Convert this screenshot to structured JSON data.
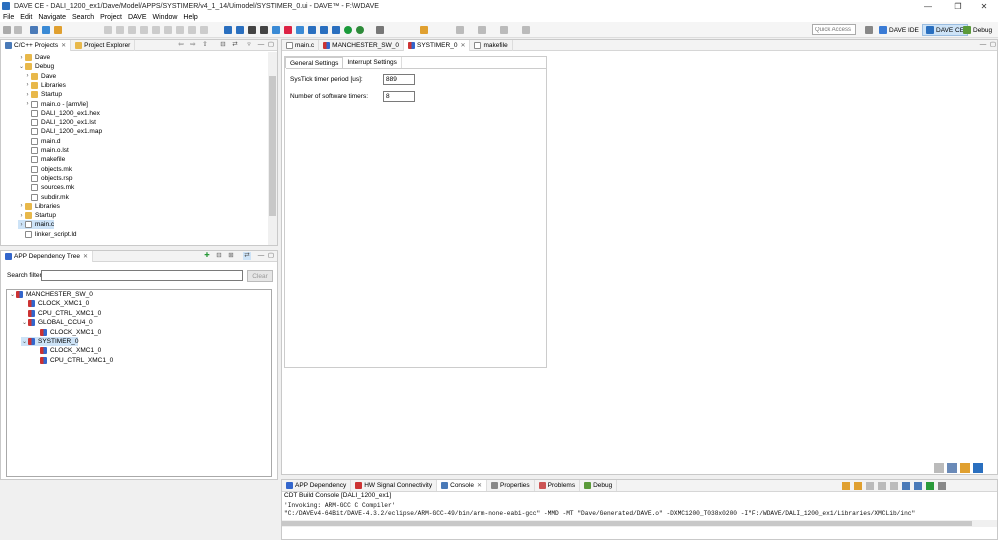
{
  "window": {
    "title": "DAVE CE - DALI_1200_ex1/Dave/Model/APPS/SYSTIMER/v4_1_14/Uimodel/SYSTIMER_0.ui - DAVE™ - F:\\WDAVE",
    "min": "—",
    "max": "❐",
    "close": "✕"
  },
  "menu": [
    "File",
    "Edit",
    "Navigate",
    "Search",
    "Project",
    "DAVE",
    "Window",
    "Help"
  ],
  "toolbar": {
    "quick_access_placeholder": "Quick Access",
    "perspectives": [
      {
        "label": "DAVE IDE",
        "color": "#3a7bd5"
      },
      {
        "label": "DAVE CE",
        "color": "#2a6fbf"
      },
      {
        "label": "Debug",
        "color": "#5a9a3a"
      }
    ]
  },
  "project_explorer": {
    "tabs": [
      "C/C++ Projects",
      "Project Explorer"
    ],
    "items": [
      {
        "label": "Dave",
        "type": "folder",
        "indent": 2,
        "twisty": "›"
      },
      {
        "label": "Debug",
        "type": "folder",
        "indent": 2,
        "twisty": "⌄"
      },
      {
        "label": "Dave",
        "type": "folder",
        "indent": 3,
        "twisty": "›"
      },
      {
        "label": "Libraries",
        "type": "folder",
        "indent": 3,
        "twisty": "›"
      },
      {
        "label": "Startup",
        "type": "folder",
        "indent": 3,
        "twisty": "›"
      },
      {
        "label": "main.o - [arm/le]",
        "type": "file",
        "indent": 3,
        "twisty": "›"
      },
      {
        "label": "DALI_1200_ex1.hex",
        "type": "file",
        "indent": 3,
        "twisty": ""
      },
      {
        "label": "DALI_1200_ex1.lst",
        "type": "file",
        "indent": 3,
        "twisty": ""
      },
      {
        "label": "DALI_1200_ex1.map",
        "type": "file",
        "indent": 3,
        "twisty": ""
      },
      {
        "label": "main.d",
        "type": "file",
        "indent": 3,
        "twisty": ""
      },
      {
        "label": "main.o.lst",
        "type": "file",
        "indent": 3,
        "twisty": ""
      },
      {
        "label": "makefile",
        "type": "file",
        "indent": 3,
        "twisty": ""
      },
      {
        "label": "objects.mk",
        "type": "file",
        "indent": 3,
        "twisty": ""
      },
      {
        "label": "objects.rsp",
        "type": "file",
        "indent": 3,
        "twisty": ""
      },
      {
        "label": "sources.mk",
        "type": "file",
        "indent": 3,
        "twisty": ""
      },
      {
        "label": "subdir.mk",
        "type": "file",
        "indent": 3,
        "twisty": ""
      },
      {
        "label": "Libraries",
        "type": "folder",
        "indent": 2,
        "twisty": "›"
      },
      {
        "label": "Startup",
        "type": "folder",
        "indent": 2,
        "twisty": "›"
      },
      {
        "label": "main.c",
        "type": "file",
        "indent": 2,
        "twisty": "›",
        "selected": true
      },
      {
        "label": "linker_script.ld",
        "type": "file",
        "indent": 2,
        "twisty": ""
      }
    ]
  },
  "app_tree": {
    "tab": "APP Dependency Tree",
    "search_label": "Search filter",
    "search_value": "",
    "clear_label": "Clear",
    "items": [
      {
        "label": "MANCHESTER_SW_0",
        "indent": 0,
        "twisty": "⌄"
      },
      {
        "label": "CLOCK_XMC1_0",
        "indent": 1,
        "twisty": ""
      },
      {
        "label": "CPU_CTRL_XMC1_0",
        "indent": 1,
        "twisty": ""
      },
      {
        "label": "GLOBAL_CCU4_0",
        "indent": 1,
        "twisty": "⌄"
      },
      {
        "label": "CLOCK_XMC1_0",
        "indent": 2,
        "twisty": ""
      },
      {
        "label": "SYSTIMER_0",
        "indent": 1,
        "twisty": "⌄",
        "selected": true
      },
      {
        "label": "CLOCK_XMC1_0",
        "indent": 2,
        "twisty": ""
      },
      {
        "label": "CPU_CTRL_XMC1_0",
        "indent": 2,
        "twisty": ""
      }
    ]
  },
  "editor": {
    "tabs": [
      {
        "label": "main.c",
        "active": false
      },
      {
        "label": "MANCHESTER_SW_0",
        "active": false
      },
      {
        "label": "SYSTIMER_0",
        "active": true
      },
      {
        "label": "makefile",
        "active": false
      }
    ],
    "sub_tabs": [
      "General Settings",
      "Interrupt Settings"
    ],
    "fields": [
      {
        "label": "SysTick timer period [us]:",
        "value": "889"
      },
      {
        "label": "Number of software timers:",
        "value": "8"
      }
    ]
  },
  "bottom": {
    "tabs": [
      "APP Dependency",
      "HW Signal Connectivity",
      "Console",
      "Properties",
      "Problems",
      "Debug"
    ],
    "active_tab": "Console",
    "console_title": "CDT Build Console [DALI_1200_ex1]",
    "lines": [
      "'Invoking: ARM-GCC C Compiler'",
      "\"C:/DAVEv4-64Bit/DAVE-4.3.2/eclipse/ARM-GCC-49/bin/arm-none-eabi-gcc\" -MMD -MT \"Dave/Generated/DAVE.o\" -DXMC1200_T038x0200 -I\"F:/WDAVE/DALI_1200_ex1/Libraries/XMCLib/inc\""
    ]
  }
}
